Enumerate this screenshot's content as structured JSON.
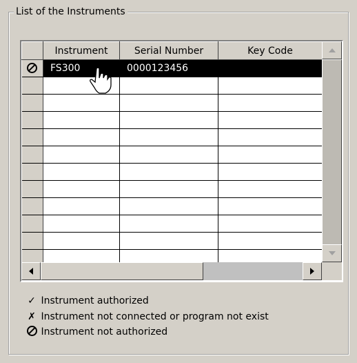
{
  "group": {
    "title": "List of the Instruments"
  },
  "grid": {
    "columns": [
      "Instrument",
      "Serial Number",
      "Key Code"
    ],
    "rows": [
      {
        "status_icon": "not-authorized-icon",
        "instrument": "FS300",
        "serial": "0000123456",
        "key_code": "",
        "selected": true
      },
      {
        "status_icon": "",
        "instrument": "",
        "serial": "",
        "key_code": "",
        "selected": false
      },
      {
        "status_icon": "",
        "instrument": "",
        "serial": "",
        "key_code": "",
        "selected": false
      },
      {
        "status_icon": "",
        "instrument": "",
        "serial": "",
        "key_code": "",
        "selected": false
      },
      {
        "status_icon": "",
        "instrument": "",
        "serial": "",
        "key_code": "",
        "selected": false
      },
      {
        "status_icon": "",
        "instrument": "",
        "serial": "",
        "key_code": "",
        "selected": false
      },
      {
        "status_icon": "",
        "instrument": "",
        "serial": "",
        "key_code": "",
        "selected": false
      },
      {
        "status_icon": "",
        "instrument": "",
        "serial": "",
        "key_code": "",
        "selected": false
      },
      {
        "status_icon": "",
        "instrument": "",
        "serial": "",
        "key_code": "",
        "selected": false
      },
      {
        "status_icon": "",
        "instrument": "",
        "serial": "",
        "key_code": "",
        "selected": false
      },
      {
        "status_icon": "",
        "instrument": "",
        "serial": "",
        "key_code": "",
        "selected": false
      },
      {
        "status_icon": "",
        "instrument": "",
        "serial": "",
        "key_code": "",
        "selected": false
      }
    ]
  },
  "legend": {
    "authorized": {
      "symbol": "✓",
      "label": "Instrument authorized"
    },
    "not_connected": {
      "symbol": "✗",
      "label": "Instrument not connected or program not exist"
    },
    "not_authorized": {
      "icon": "not-authorized-icon",
      "label": "Instrument not authorized"
    }
  },
  "colors": {
    "window_bg": "#d4d0c8",
    "selection_bg": "#000000",
    "selection_fg": "#ffffff"
  }
}
